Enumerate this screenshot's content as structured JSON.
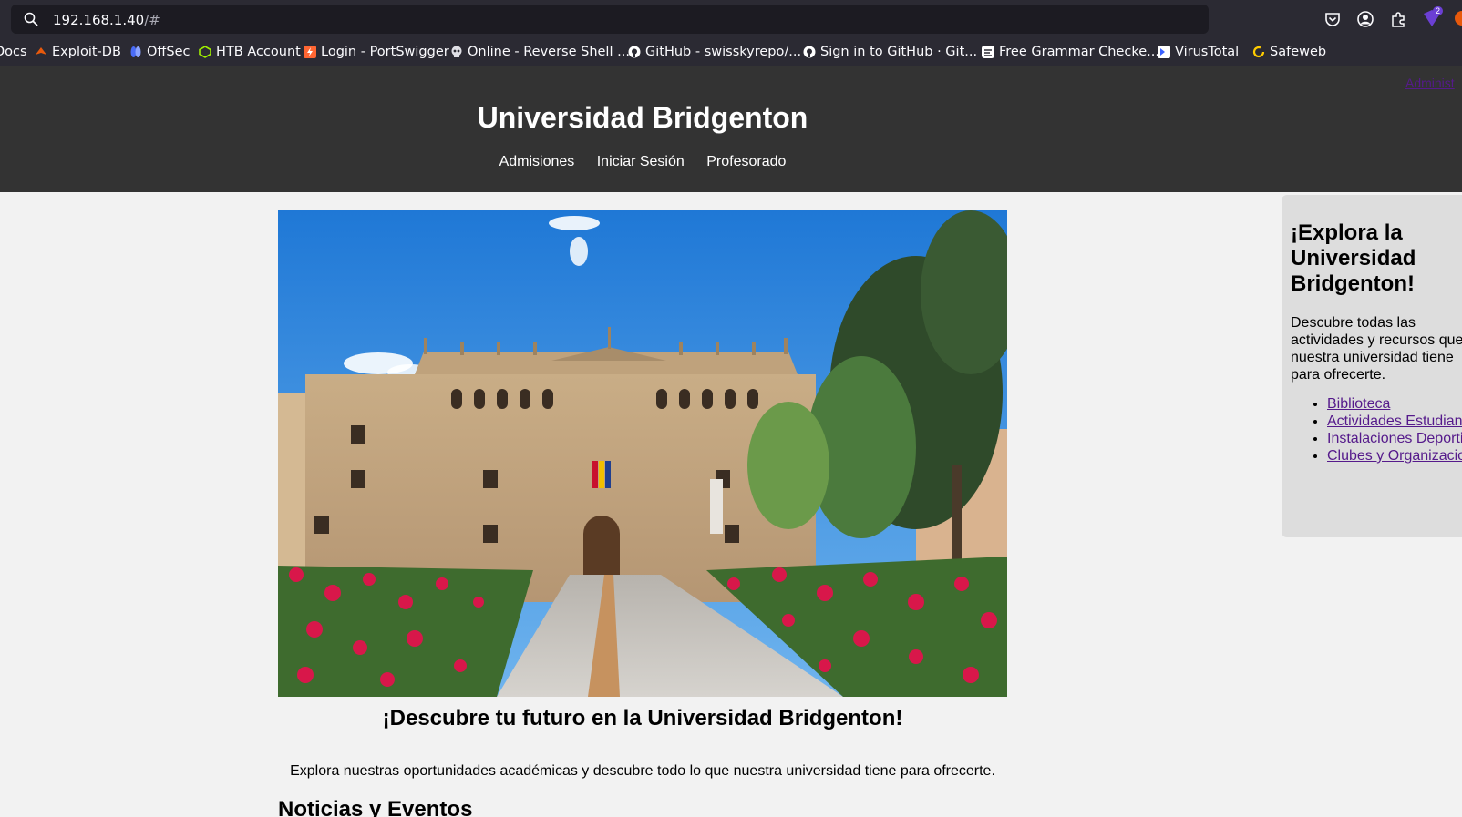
{
  "browser": {
    "url_host": "192.168.1.40",
    "url_path": "/#",
    "extension_badge": "2",
    "bookmarks": [
      {
        "label": "Docs",
        "icon": "docs-icon",
        "color": ""
      },
      {
        "label": "Exploit-DB",
        "icon": "exploit-db-icon",
        "color": "#e8590c"
      },
      {
        "label": "OffSec",
        "icon": "offsec-icon",
        "color": "#4a6cf7"
      },
      {
        "label": "HTB Account",
        "icon": "htb-icon",
        "color": "#9fef00"
      },
      {
        "label": "Login - PortSwigger",
        "icon": "portswigger-icon",
        "color": "#ff6633"
      },
      {
        "label": "Online - Reverse Shell ...",
        "icon": "skull-icon",
        "color": "#e0e0e6"
      },
      {
        "label": "GitHub - swisskyrepo/...",
        "icon": "github-icon",
        "color": "#ffffff"
      },
      {
        "label": "Sign in to GitHub · Git...",
        "icon": "github-icon",
        "color": "#ffffff"
      },
      {
        "label": "Free Grammar Checke...",
        "icon": "grammar-icon",
        "color": "#ffffff"
      },
      {
        "label": "VirusTotal",
        "icon": "virustotal-icon",
        "color": "#3b61ff"
      },
      {
        "label": "Safeweb",
        "icon": "safeweb-icon",
        "color": "#ffcc00"
      }
    ]
  },
  "site": {
    "admin_link": "Administ",
    "title": "Universidad Bridgenton",
    "nav": [
      "Admisiones",
      "Iniciar Sesión",
      "Profesorado"
    ],
    "tagline": "¡Descubre tu futuro en la Universidad Bridgenton!",
    "intro": "Explora nuestras oportunidades académicas y descubre todo lo que nuestra universidad tiene para ofrecerte.",
    "news_heading": "Noticias y Eventos",
    "aside": {
      "title": "¡Explora la Universidad Bridgenton!",
      "description": "Descubre todas las actividades y recursos que nuestra universidad tiene para ofrecerte.",
      "links": [
        "Biblioteca",
        "Actividades Estudiantiles",
        "Instalaciones Deportivas",
        "Clubes y Organizaciones"
      ]
    }
  },
  "colors": {
    "header_bg": "#333333",
    "page_bg": "#f2f2f2",
    "aside_bg": "#dddddd",
    "visited_link": "#551a8b",
    "browser_chrome": "#2b2a33"
  }
}
